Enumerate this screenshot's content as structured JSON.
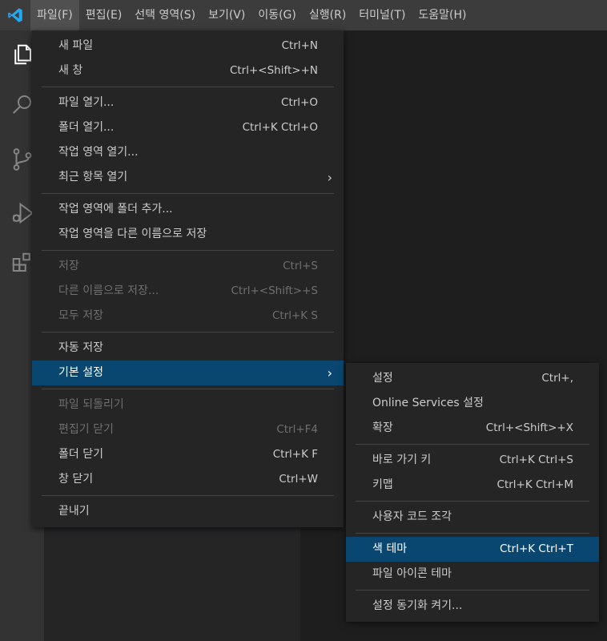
{
  "menubar": {
    "items": [
      "파일(F)",
      "편집(E)",
      "선택 영역(S)",
      "보기(V)",
      "이동(G)",
      "실행(R)",
      "터미널(T)",
      "도움말(H)"
    ]
  },
  "file_menu": {
    "new_file": {
      "label": "새 파일",
      "keys": "Ctrl+N"
    },
    "new_window": {
      "label": "새 창",
      "keys": "Ctrl+<Shift>+N"
    },
    "open_file": {
      "label": "파일 열기...",
      "keys": "Ctrl+O"
    },
    "open_folder": {
      "label": "폴더 열기...",
      "keys": "Ctrl+K Ctrl+O"
    },
    "open_workspace": {
      "label": "작업 영역 열기...",
      "keys": ""
    },
    "open_recent": {
      "label": "최근 항목 열기",
      "chevron": "›"
    },
    "add_folder": {
      "label": "작업 영역에 폴더 추가...",
      "keys": ""
    },
    "save_workspace_as": {
      "label": "작업 영역을 다른 이름으로 저장",
      "keys": ""
    },
    "save": {
      "label": "저장",
      "keys": "Ctrl+S"
    },
    "save_as": {
      "label": "다른 이름으로 저장...",
      "keys": "Ctrl+<Shift>+S"
    },
    "save_all": {
      "label": "모두 저장",
      "keys": "Ctrl+K S"
    },
    "auto_save": {
      "label": "자동 저장",
      "keys": ""
    },
    "preferences": {
      "label": "기본 설정",
      "chevron": "›"
    },
    "revert_file": {
      "label": "파일 되돌리기",
      "keys": ""
    },
    "close_editor": {
      "label": "편집기 닫기",
      "keys": "Ctrl+F4"
    },
    "close_folder": {
      "label": "폴더 닫기",
      "keys": "Ctrl+K F"
    },
    "close_window": {
      "label": "창 닫기",
      "keys": "Ctrl+W"
    },
    "exit": {
      "label": "끝내기",
      "keys": ""
    }
  },
  "preferences_menu": {
    "settings": {
      "label": "설정",
      "keys": "Ctrl+,"
    },
    "online_services": {
      "label": "Online Services 설정",
      "keys": ""
    },
    "extensions": {
      "label": "확장",
      "keys": "Ctrl+<Shift>+X"
    },
    "keyboard_shortcuts": {
      "label": "바로 가기 키",
      "keys": "Ctrl+K Ctrl+S"
    },
    "keymaps": {
      "label": "키맵",
      "keys": "Ctrl+K Ctrl+M"
    },
    "user_snippets": {
      "label": "사용자 코드 조각",
      "keys": ""
    },
    "color_theme": {
      "label": "색 테마",
      "keys": "Ctrl+K Ctrl+T"
    },
    "file_icon_theme": {
      "label": "파일 아이콘 테마",
      "keys": ""
    },
    "settings_sync": {
      "label": "설정 동기화 켜기...",
      "keys": ""
    }
  },
  "colors": {
    "accent": "#094771",
    "logo": "#23a9f2"
  }
}
